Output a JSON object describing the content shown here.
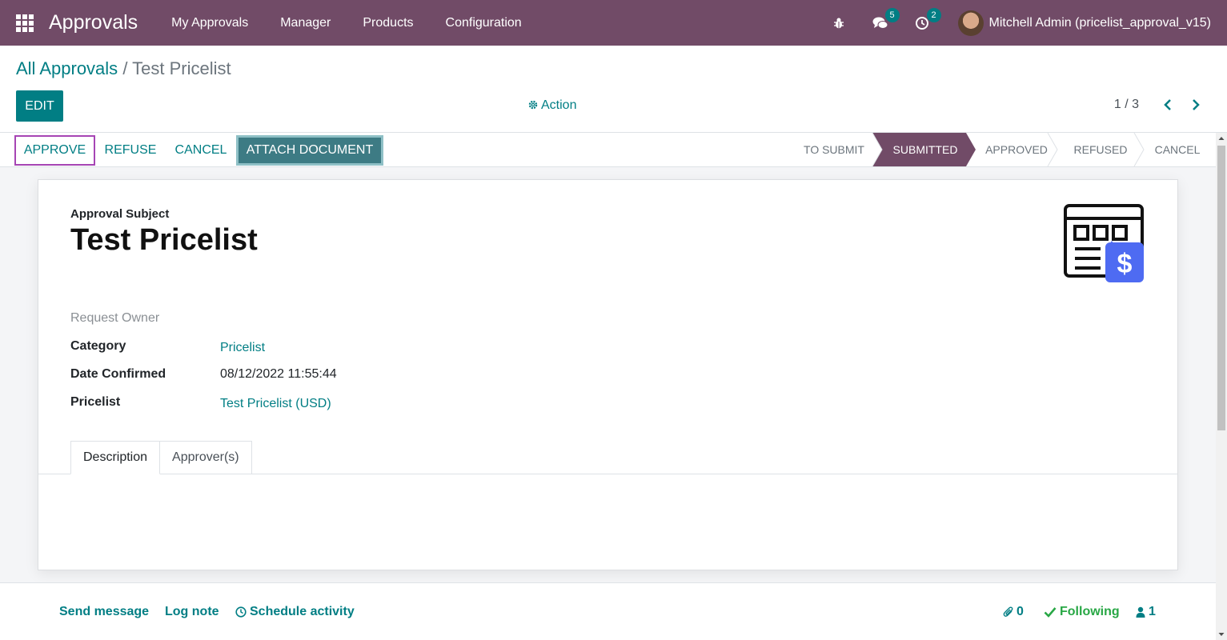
{
  "navbar": {
    "brand": "Approvals",
    "menu": [
      "My Approvals",
      "Manager",
      "Products",
      "Configuration"
    ],
    "messages_badge": "5",
    "activities_badge": "2",
    "user_name": "Mitchell Admin (pricelist_approval_v15)"
  },
  "breadcrumb": {
    "parent": "All Approvals",
    "separator": "/",
    "current": "Test Pricelist"
  },
  "control": {
    "edit_label": "EDIT",
    "action_label": "Action",
    "pager": "1 / 3"
  },
  "statusbar": {
    "buttons": {
      "approve": "APPROVE",
      "refuse": "REFUSE",
      "cancel": "CANCEL",
      "attach": "ATTACH DOCUMENT"
    },
    "stages": [
      "TO SUBMIT",
      "SUBMITTED",
      "APPROVED",
      "REFUSED",
      "CANCEL"
    ],
    "active_stage": "SUBMITTED"
  },
  "form": {
    "subject_label": "Approval Subject",
    "subject": "Test Pricelist",
    "request_owner_label": "Request Owner",
    "fields": {
      "category_label": "Category",
      "category_value": "Pricelist",
      "date_label": "Date Confirmed",
      "date_value": "08/12/2022 11:55:44",
      "pricelist_label": "Pricelist",
      "pricelist_value": "Test Pricelist (USD)"
    },
    "tabs": [
      "Description",
      "Approver(s)"
    ],
    "active_tab": "Description"
  },
  "chatter": {
    "send_message": "Send message",
    "log_note": "Log note",
    "schedule_activity": "Schedule activity",
    "attachments_count": "0",
    "following": "Following",
    "followers_count": "1"
  },
  "colors": {
    "navbar": "#714b67",
    "primary": "#017e84",
    "active_stage": "#714b67",
    "dollar_badge": "#4e6bf2"
  }
}
